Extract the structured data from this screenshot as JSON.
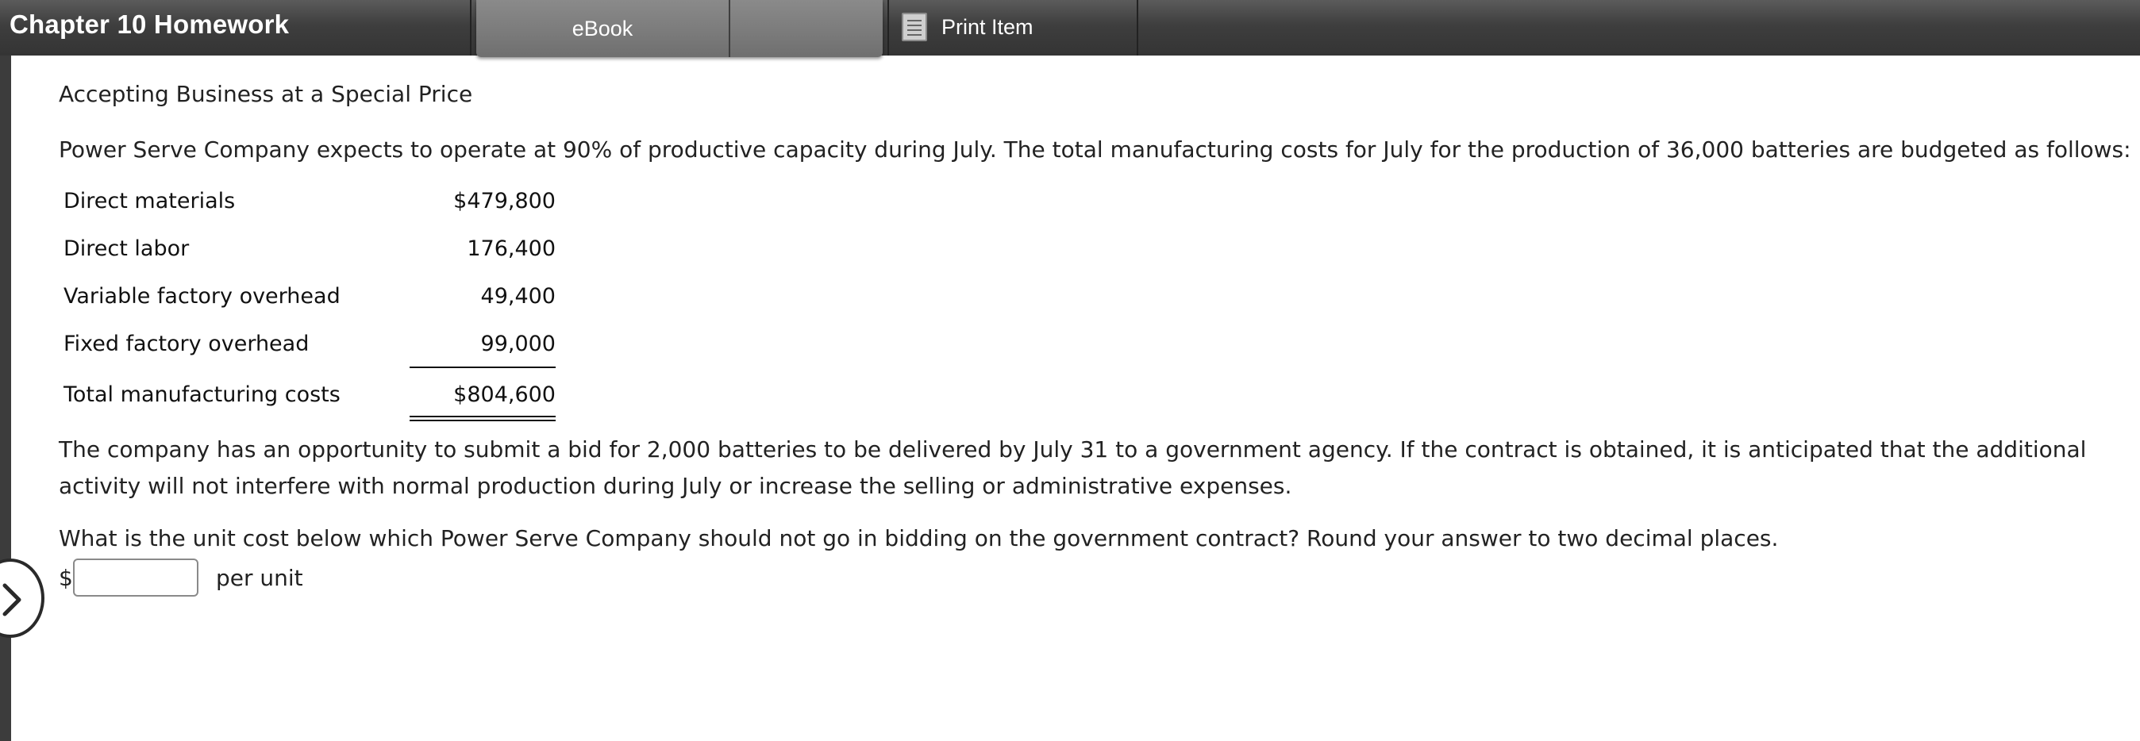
{
  "header": {
    "title": "Chapter 10 Homework",
    "tabs": [
      {
        "label": "eBook"
      },
      {
        "label": ""
      }
    ],
    "print_label": "Print Item"
  },
  "problem": {
    "title": "Accepting Business at a Special Price",
    "intro": "Power Serve Company expects to operate at 90% of productive capacity during July. The total manufacturing costs for July for the production of 36,000 batteries are budgeted as follows:",
    "costs": [
      {
        "label": "Direct materials",
        "amount": "$479,800"
      },
      {
        "label": "Direct labor",
        "amount": "176,400"
      },
      {
        "label": "Variable factory overhead",
        "amount": "49,400"
      },
      {
        "label": "Fixed factory overhead",
        "amount": "99,000"
      }
    ],
    "total": {
      "label": "Total manufacturing costs",
      "amount": "$804,600"
    },
    "paragraph": "The company has an opportunity to submit a bid for 2,000 batteries to be delivered by July 31 to a government agency. If the contract is obtained, it is anticipated that the additional activity will not interfere with normal production during July or increase the selling or administrative expenses.",
    "question": "What is the unit cost below which Power Serve Company should not go in bidding on the government contract? Round your answer to two decimal places.",
    "answer": {
      "prefix": "$",
      "value": "",
      "suffix": "per unit"
    }
  },
  "icons": {
    "print": "print-icon",
    "nav": "chevron-right-icon"
  },
  "colors": {
    "topbar": "#3e3e3e",
    "tab_active": "#7a7a7a",
    "text": "#222222"
  }
}
